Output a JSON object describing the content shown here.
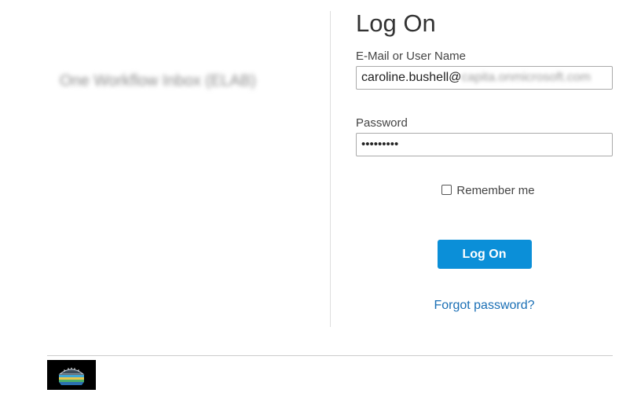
{
  "app": {
    "name": "One Workflow Inbox (ELAB)"
  },
  "login": {
    "title": "Log On",
    "email_label": "E-Mail or User Name",
    "email_user": "caroline.bushell@",
    "email_domain": "capita.onmicrosoft.com",
    "password_label": "Password",
    "password_value": "•••••••••",
    "remember_label": "Remember me",
    "remember_checked": false,
    "logon_button": "Log On",
    "forgot_link": "Forgot password?"
  },
  "colors": {
    "button": "#0b8fd8",
    "link": "#1a6fb5"
  },
  "footer": {
    "logo_icon": "company-logo-icon"
  }
}
